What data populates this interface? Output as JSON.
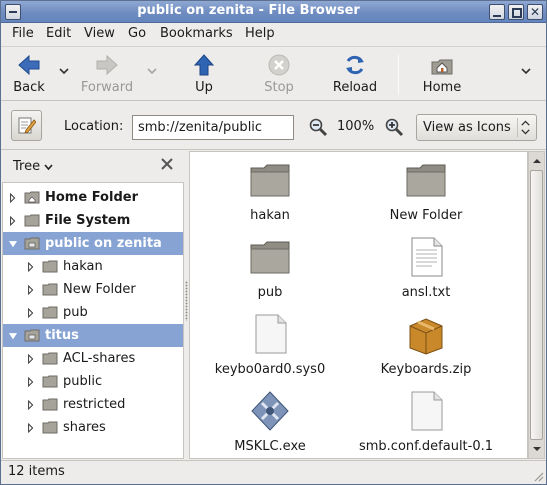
{
  "window": {
    "title": "public on zenita - File Browser",
    "close_glyph": "✕"
  },
  "menubar": [
    {
      "label": "File"
    },
    {
      "label": "Edit"
    },
    {
      "label": "View"
    },
    {
      "label": "Go"
    },
    {
      "label": "Bookmarks"
    },
    {
      "label": "Help"
    }
  ],
  "toolbar": {
    "back": "Back",
    "forward": "Forward",
    "up": "Up",
    "stop": "Stop",
    "reload": "Reload",
    "home": "Home"
  },
  "location": {
    "label": "Location:",
    "value": "smb://zenita/public",
    "zoom": "100%",
    "view_mode": "View as Icons"
  },
  "sidebar": {
    "mode": "Tree",
    "close_glyph": "✕",
    "items": [
      {
        "label": "Home Folder",
        "bold": true,
        "selected": false,
        "icon": "home-folder-icon"
      },
      {
        "label": "File System",
        "bold": true,
        "selected": false,
        "icon": "folder-icon"
      },
      {
        "label": "public on zenita",
        "bold": true,
        "selected": true,
        "expanded": true,
        "icon": "network-folder-icon"
      },
      {
        "label": "hakan",
        "bold": false,
        "selected": false,
        "icon": "folder-icon"
      },
      {
        "label": "New Folder",
        "bold": false,
        "selected": false,
        "icon": "folder-icon"
      },
      {
        "label": "pub",
        "bold": false,
        "selected": false,
        "icon": "folder-icon"
      },
      {
        "label": "titus",
        "bold": true,
        "selected": true,
        "expanded": true,
        "icon": "network-folder-icon"
      },
      {
        "label": "ACL-shares",
        "bold": false,
        "selected": false,
        "icon": "folder-icon"
      },
      {
        "label": "public",
        "bold": false,
        "selected": false,
        "icon": "folder-icon"
      },
      {
        "label": "restricted",
        "bold": false,
        "selected": false,
        "icon": "folder-icon"
      },
      {
        "label": "shares",
        "bold": false,
        "selected": false,
        "icon": "folder-icon"
      }
    ]
  },
  "files": [
    {
      "name": "hakan",
      "icon": "folder-icon"
    },
    {
      "name": "New Folder",
      "icon": "folder-icon"
    },
    {
      "name": "pub",
      "icon": "folder-icon"
    },
    {
      "name": "ansl.txt",
      "icon": "text-file-icon"
    },
    {
      "name": "keybo0ard0.sys0",
      "icon": "blank-file-icon"
    },
    {
      "name": "Keyboards.zip",
      "icon": "archive-icon"
    },
    {
      "name": "MSKLC.exe",
      "icon": "executable-icon"
    },
    {
      "name": "smb.conf.default-0.1",
      "icon": "blank-file-icon"
    }
  ],
  "status": {
    "text": "12 items"
  },
  "colors": {
    "titlebar": "#6f8cc0",
    "selection": "#86a3d3",
    "folder": "#8f8c84",
    "back_arrow": "#3d6cb8",
    "up_arrow": "#2f64b3"
  }
}
